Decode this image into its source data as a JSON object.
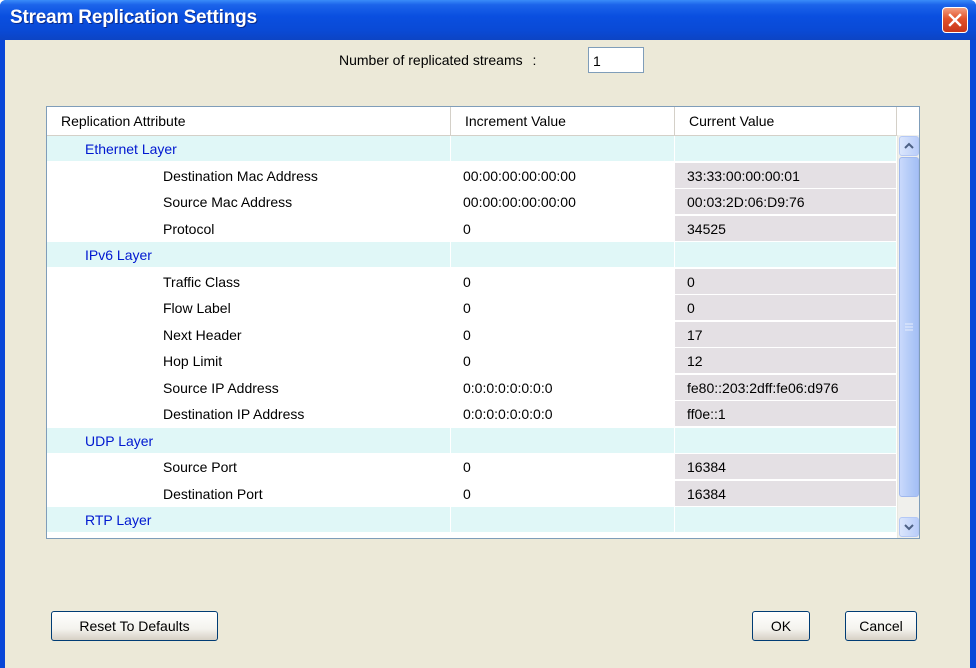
{
  "window": {
    "title": "Stream Replication Settings"
  },
  "count": {
    "label": "Number of replicated streams",
    "separator": ":",
    "value": "1"
  },
  "grid": {
    "headers": [
      "Replication Attribute",
      "Increment Value",
      "Current Value"
    ],
    "rows": [
      {
        "type": "layer",
        "attribute": "Ethernet Layer",
        "increment": "",
        "current": ""
      },
      {
        "type": "attr",
        "attribute": "Destination Mac Address",
        "increment": "00:00:00:00:00:00",
        "current": "33:33:00:00:00:01"
      },
      {
        "type": "attr",
        "attribute": "Source Mac Address",
        "increment": "00:00:00:00:00:00",
        "current": "00:03:2D:06:D9:76"
      },
      {
        "type": "attr",
        "attribute": "Protocol",
        "increment": "0",
        "current": "34525"
      },
      {
        "type": "layer",
        "attribute": "IPv6 Layer",
        "increment": "",
        "current": ""
      },
      {
        "type": "attr",
        "attribute": "Traffic Class",
        "increment": "0",
        "current": "0"
      },
      {
        "type": "attr",
        "attribute": "Flow Label",
        "increment": "0",
        "current": "0"
      },
      {
        "type": "attr",
        "attribute": "Next Header",
        "increment": "0",
        "current": "17"
      },
      {
        "type": "attr",
        "attribute": "Hop Limit",
        "increment": "0",
        "current": "12"
      },
      {
        "type": "attr",
        "attribute": "Source IP Address",
        "increment": "0:0:0:0:0:0:0:0",
        "current": "fe80::203:2dff:fe06:d976"
      },
      {
        "type": "attr",
        "attribute": "Destination IP Address",
        "increment": "0:0:0:0:0:0:0:0",
        "current": "ff0e::1"
      },
      {
        "type": "layer",
        "attribute": "UDP Layer",
        "increment": "",
        "current": ""
      },
      {
        "type": "attr",
        "attribute": "Source Port",
        "increment": "0",
        "current": "16384"
      },
      {
        "type": "attr",
        "attribute": "Destination Port",
        "increment": "0",
        "current": "16384"
      },
      {
        "type": "layer",
        "attribute": "RTP Layer",
        "increment": "",
        "current": ""
      }
    ]
  },
  "buttons": {
    "reset": "Reset To Defaults",
    "ok": "OK",
    "cancel": "Cancel"
  },
  "colors": {
    "titlebar": "#0a4fe0",
    "layer_row_bg": "#e0f7f7",
    "layer_text": "#0018d0",
    "current_value_bg": "#e4e0e4",
    "dialog_bg": "#ece9d8",
    "close_button": "#e2522a"
  },
  "icons": {
    "close": "close-x-icon",
    "scroll_up": "chevron-up-icon",
    "scroll_down": "chevron-down-icon",
    "scroll_grip": "grip-icon"
  }
}
